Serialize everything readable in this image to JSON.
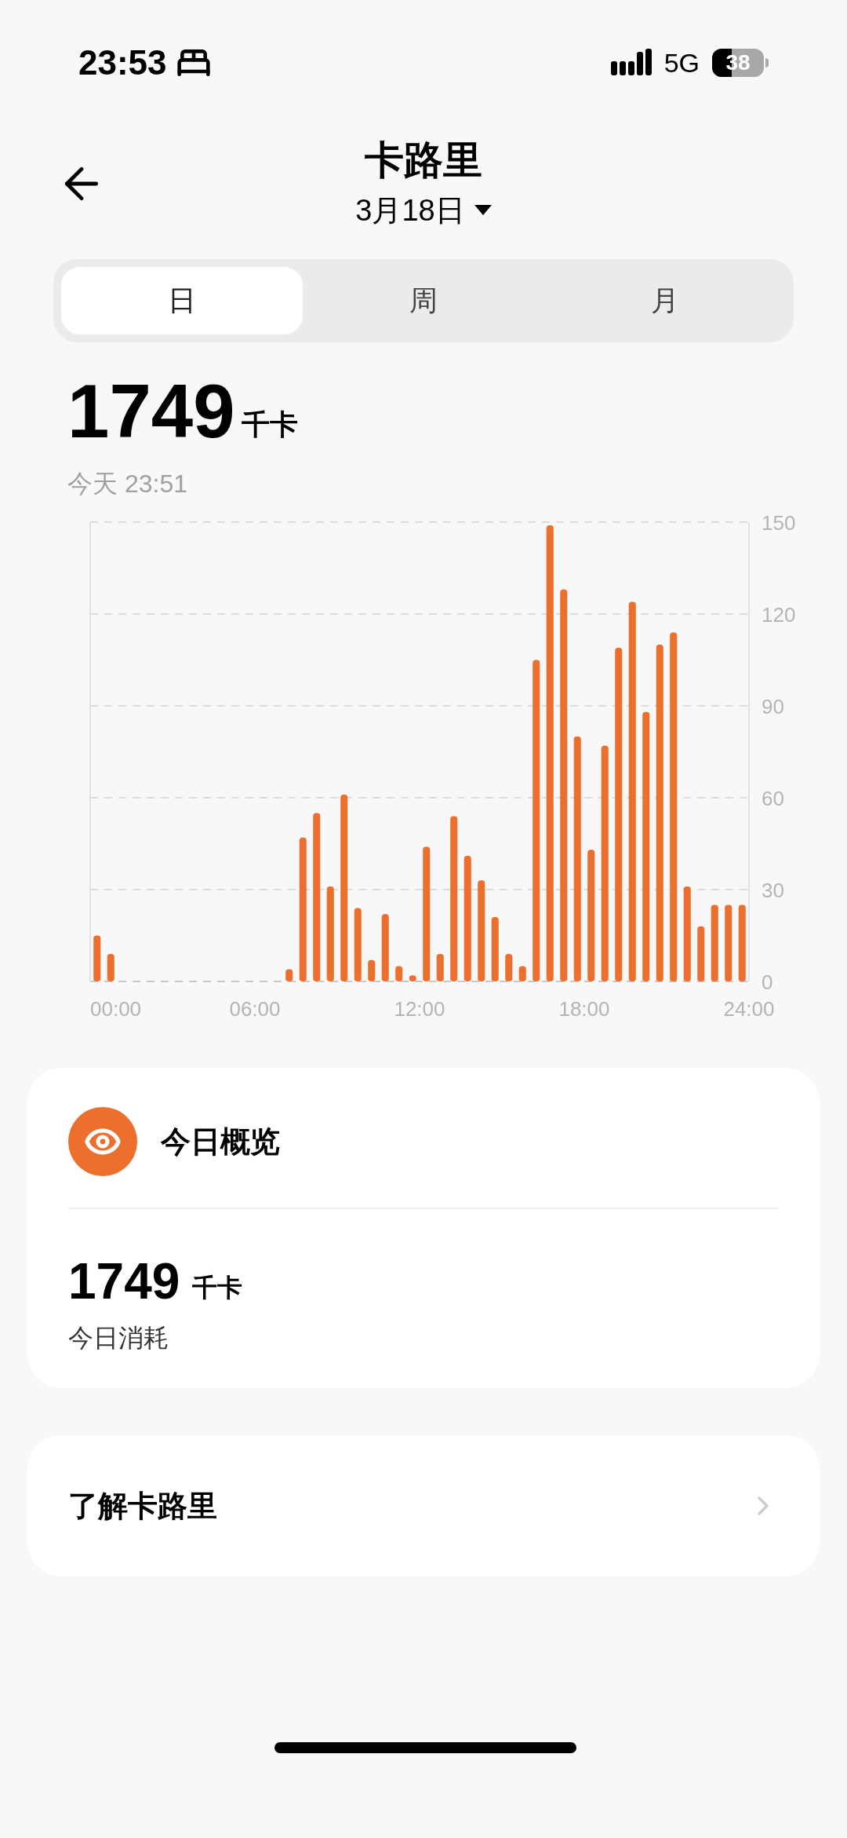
{
  "status_bar": {
    "time": "23:53",
    "network": "5G",
    "battery": "38"
  },
  "header": {
    "title": "卡路里",
    "date": "3月18日"
  },
  "tabs": [
    {
      "label": "日",
      "selected": true
    },
    {
      "label": "周",
      "selected": false
    },
    {
      "label": "月",
      "selected": false
    }
  ],
  "summary": {
    "value": "1749",
    "unit": "千卡",
    "time": "今天 23:51"
  },
  "chart": {
    "chart_data": {
      "type": "bar",
      "grid": true,
      "x": [
        0.25,
        0.75,
        1.25,
        1.75,
        2.25,
        2.75,
        3.25,
        3.75,
        4.25,
        4.75,
        5.25,
        5.75,
        6.25,
        6.75,
        7.25,
        7.75,
        8.25,
        8.75,
        9.25,
        9.75,
        10.25,
        10.75,
        11.25,
        11.75,
        12.25,
        12.75,
        13.25,
        13.75,
        14.25,
        14.75,
        15.25,
        15.75,
        16.25,
        16.75,
        17.25,
        17.75,
        18.25,
        18.75,
        19.25,
        19.75,
        20.25,
        20.75,
        21.25,
        21.75,
        22.25,
        22.75,
        23.25,
        23.75
      ],
      "series": [
        {
          "color": "#ec6f2d",
          "values": [
            15,
            9,
            0,
            0,
            0,
            0,
            0,
            0,
            0,
            0,
            0,
            0,
            0,
            0,
            4,
            47,
            55,
            31,
            61,
            24,
            7,
            22,
            5,
            2,
            44,
            9,
            54,
            41,
            33,
            21,
            9,
            5,
            105,
            149,
            128,
            80,
            43,
            77,
            109,
            124,
            88,
            110,
            114,
            31,
            18,
            25,
            25,
            25
          ]
        }
      ],
      "xlim": [
        0,
        24
      ],
      "ylim": [
        0,
        150
      ],
      "xticks": [
        {
          "value": 0,
          "label": "00:00"
        },
        {
          "value": 6,
          "label": "06:00"
        },
        {
          "value": 12,
          "label": "12:00"
        },
        {
          "value": 18,
          "label": "18:00"
        },
        {
          "value": 24,
          "label": "24:00"
        }
      ],
      "yticks": [
        0,
        30,
        60,
        90,
        120,
        150
      ]
    }
  },
  "overview": {
    "title": "今日概览",
    "value": "1749",
    "unit": "千卡",
    "label": "今日消耗"
  },
  "learn_more": {
    "label": "了解卡路里"
  }
}
